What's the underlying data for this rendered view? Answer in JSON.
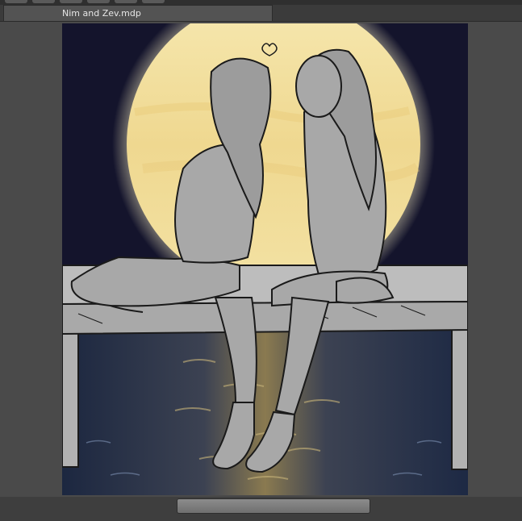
{
  "document_tab": {
    "title": "Nim and Zev.mdp"
  },
  "artwork": {
    "subject": "illustration",
    "colors": {
      "sky": "#13132a",
      "moon": "#f1dd9a",
      "moon_glow": "#fff6c8",
      "water": "#1e2a44",
      "reflection": "#b49a5a",
      "figures": "#a5a5a5",
      "lineart": "#1a1a1a"
    }
  },
  "icons": {
    "scroll_thumb": "horizontal-scrollbar-thumb"
  }
}
